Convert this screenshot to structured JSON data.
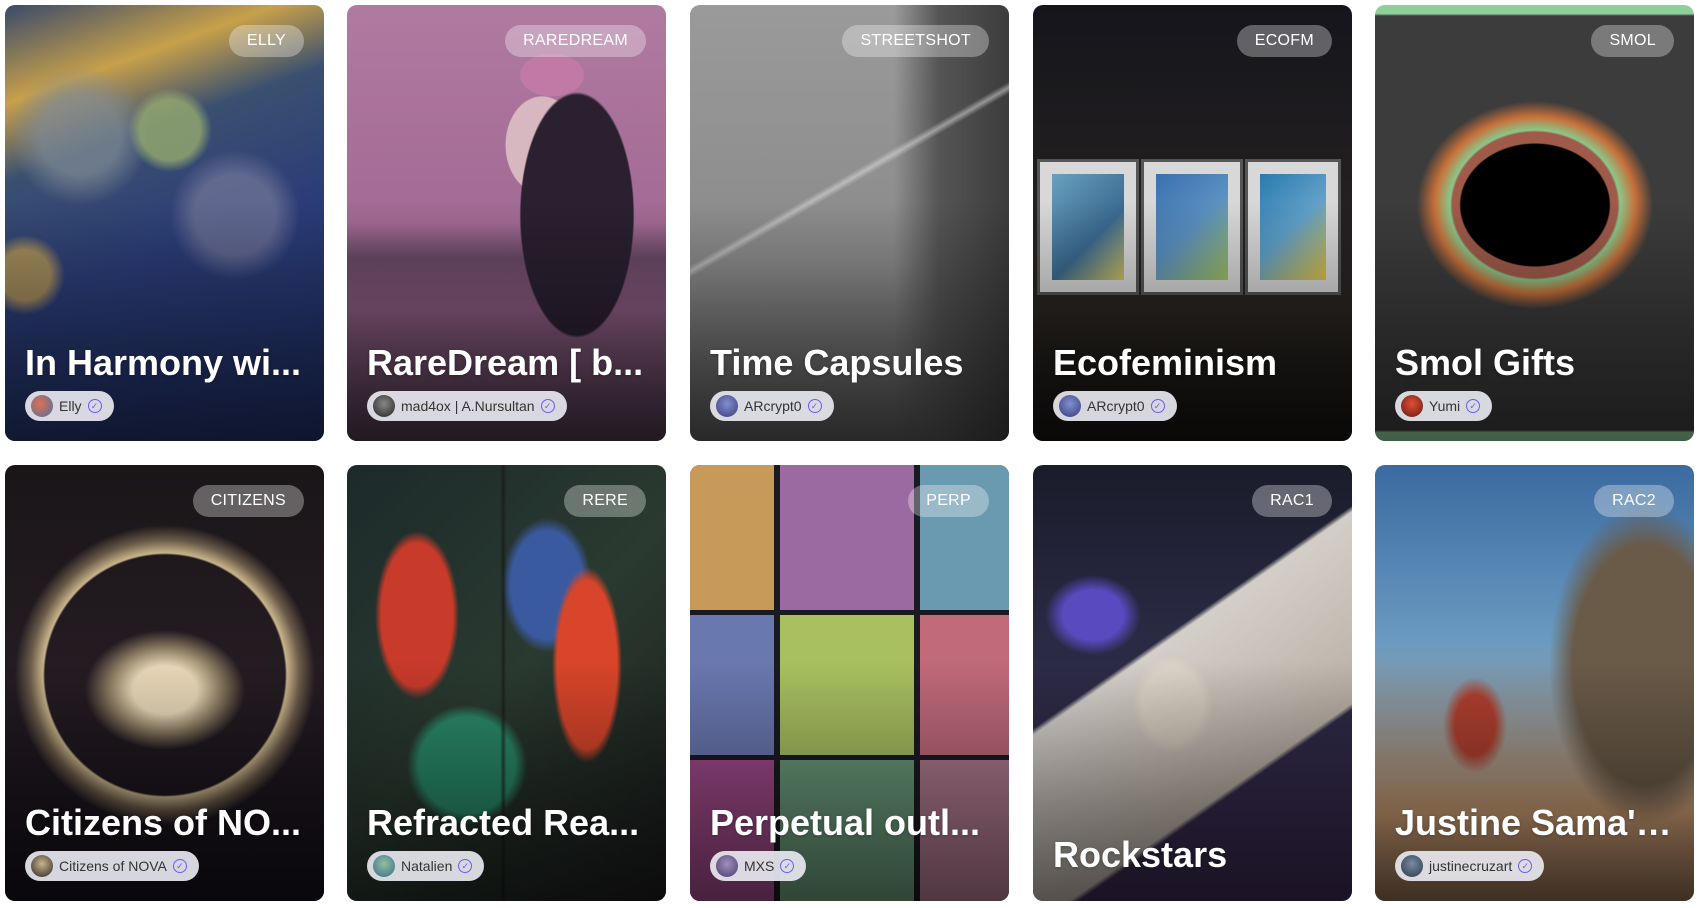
{
  "cards": [
    {
      "tag": "ELLY",
      "title": "In Harmony wi...",
      "creator": "Elly"
    },
    {
      "tag": "RAREDREAM",
      "title": "RareDream [ b...",
      "creator": "mad4ox | A.Nursultan"
    },
    {
      "tag": "STREETSHOT",
      "title": "Time Capsules",
      "creator": "ARcrypt0"
    },
    {
      "tag": "ECOFM",
      "title": "Ecofeminism",
      "creator": "ARcrypt0"
    },
    {
      "tag": "SMOL",
      "title": "Smol Gifts",
      "creator": "Yumi"
    },
    {
      "tag": "CITIZENS",
      "title": "Citizens of NO...",
      "creator": "Citizens of NOVA"
    },
    {
      "tag": "RERE",
      "title": "Refracted Rea...",
      "creator": "Natalien"
    },
    {
      "tag": "PERP",
      "title": "Perpetual outl...",
      "creator": "MXS"
    },
    {
      "tag": "RAC1",
      "title": "Rockstars",
      "creator": ""
    },
    {
      "tag": "RAC2",
      "title": "Justine Sama's...",
      "creator": "justinecruzart"
    }
  ],
  "icons": {
    "verified": "verified-badge-icon"
  }
}
